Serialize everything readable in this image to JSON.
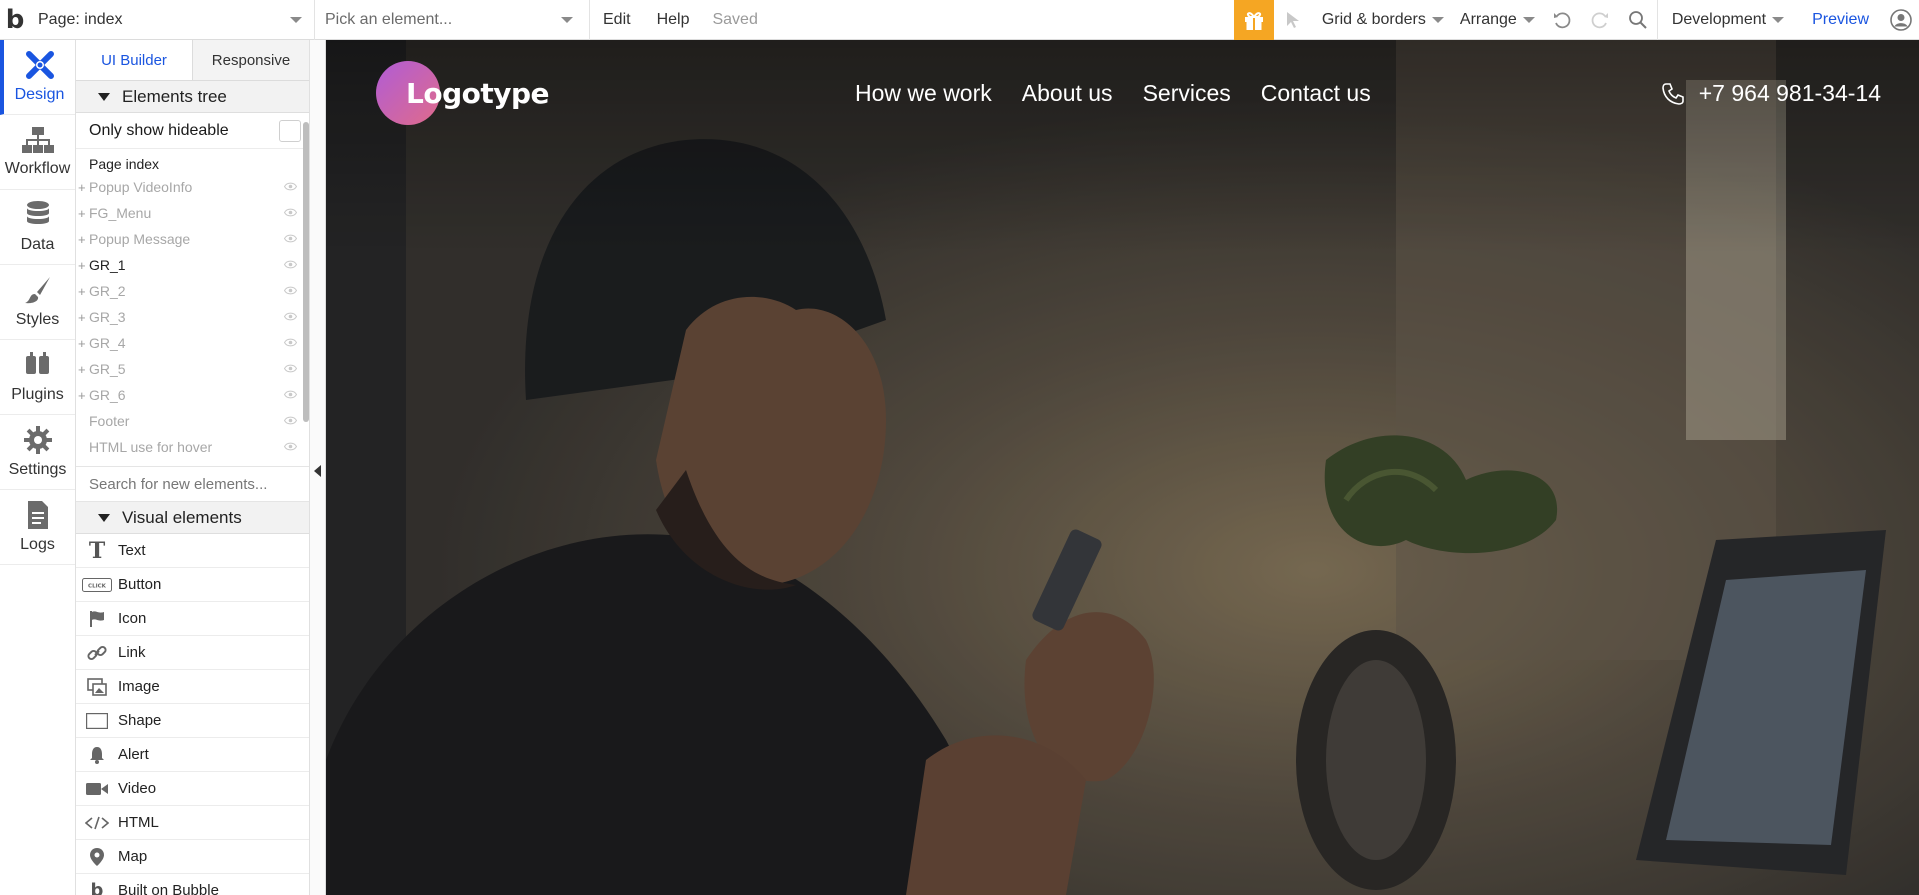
{
  "topbar": {
    "logo_glyph": "b",
    "page_selector": "Page: index",
    "element_picker_placeholder": "Pick an element...",
    "menu_edit": "Edit",
    "menu_help": "Help",
    "save_status": "Saved",
    "grid_borders": "Grid & borders",
    "arrange": "Arrange",
    "environment": "Development",
    "preview": "Preview",
    "icons": [
      "gift-icon",
      "cursor-icon",
      "undo-icon",
      "redo-icon",
      "search-icon",
      "user-icon"
    ]
  },
  "leftnav": {
    "items": [
      {
        "label": "Design",
        "icon": "design-icon",
        "active": true
      },
      {
        "label": "Workflow",
        "icon": "workflow-icon",
        "active": false
      },
      {
        "label": "Data",
        "icon": "database-icon",
        "active": false
      },
      {
        "label": "Styles",
        "icon": "brush-icon",
        "active": false
      },
      {
        "label": "Plugins",
        "icon": "plug-icon",
        "active": false
      },
      {
        "label": "Settings",
        "icon": "gear-icon",
        "active": false
      },
      {
        "label": "Logs",
        "icon": "document-icon",
        "active": false
      }
    ]
  },
  "panel": {
    "tabs": [
      "UI Builder",
      "Responsive"
    ],
    "elements_tree_title": "Elements tree",
    "only_show_hideable": "Only show hideable",
    "tree_root": "Page index",
    "tree": [
      {
        "label": "Popup VideoInfo",
        "expandable": true,
        "visible": false
      },
      {
        "label": "FG_Menu",
        "expandable": true,
        "visible": false
      },
      {
        "label": "Popup Message",
        "expandable": true,
        "visible": false
      },
      {
        "label": "GR_1",
        "expandable": true,
        "visible": true
      },
      {
        "label": "GR_2",
        "expandable": true,
        "visible": false
      },
      {
        "label": "GR_3",
        "expandable": true,
        "visible": false
      },
      {
        "label": "GR_4",
        "expandable": true,
        "visible": false
      },
      {
        "label": "GR_5",
        "expandable": true,
        "visible": false
      },
      {
        "label": "GR_6",
        "expandable": true,
        "visible": false
      },
      {
        "label": "Footer",
        "expandable": false,
        "visible": false
      },
      {
        "label": "HTML use for hover",
        "expandable": false,
        "visible": false
      }
    ],
    "search_placeholder": "Search for new elements...",
    "visual_elements_title": "Visual elements",
    "visual_elements": [
      {
        "label": "Text",
        "icon": "text-icon"
      },
      {
        "label": "Button",
        "icon": "button-icon"
      },
      {
        "label": "Icon",
        "icon": "flag-icon"
      },
      {
        "label": "Link",
        "icon": "link-icon"
      },
      {
        "label": "Image",
        "icon": "image-icon"
      },
      {
        "label": "Shape",
        "icon": "shape-icon"
      },
      {
        "label": "Alert",
        "icon": "bell-icon"
      },
      {
        "label": "Video",
        "icon": "video-icon"
      },
      {
        "label": "HTML",
        "icon": "code-icon"
      },
      {
        "label": "Map",
        "icon": "map-pin-icon"
      },
      {
        "label": "Built on Bubble",
        "icon": "bubble-icon"
      }
    ]
  },
  "canvas": {
    "logo": "Logotype",
    "nav": [
      "How we work",
      "About us",
      "Services",
      "Contact us"
    ],
    "phone": "+7 964 981-34-14",
    "accent": "#f5a623",
    "brand_blue": "#1a55e0"
  }
}
